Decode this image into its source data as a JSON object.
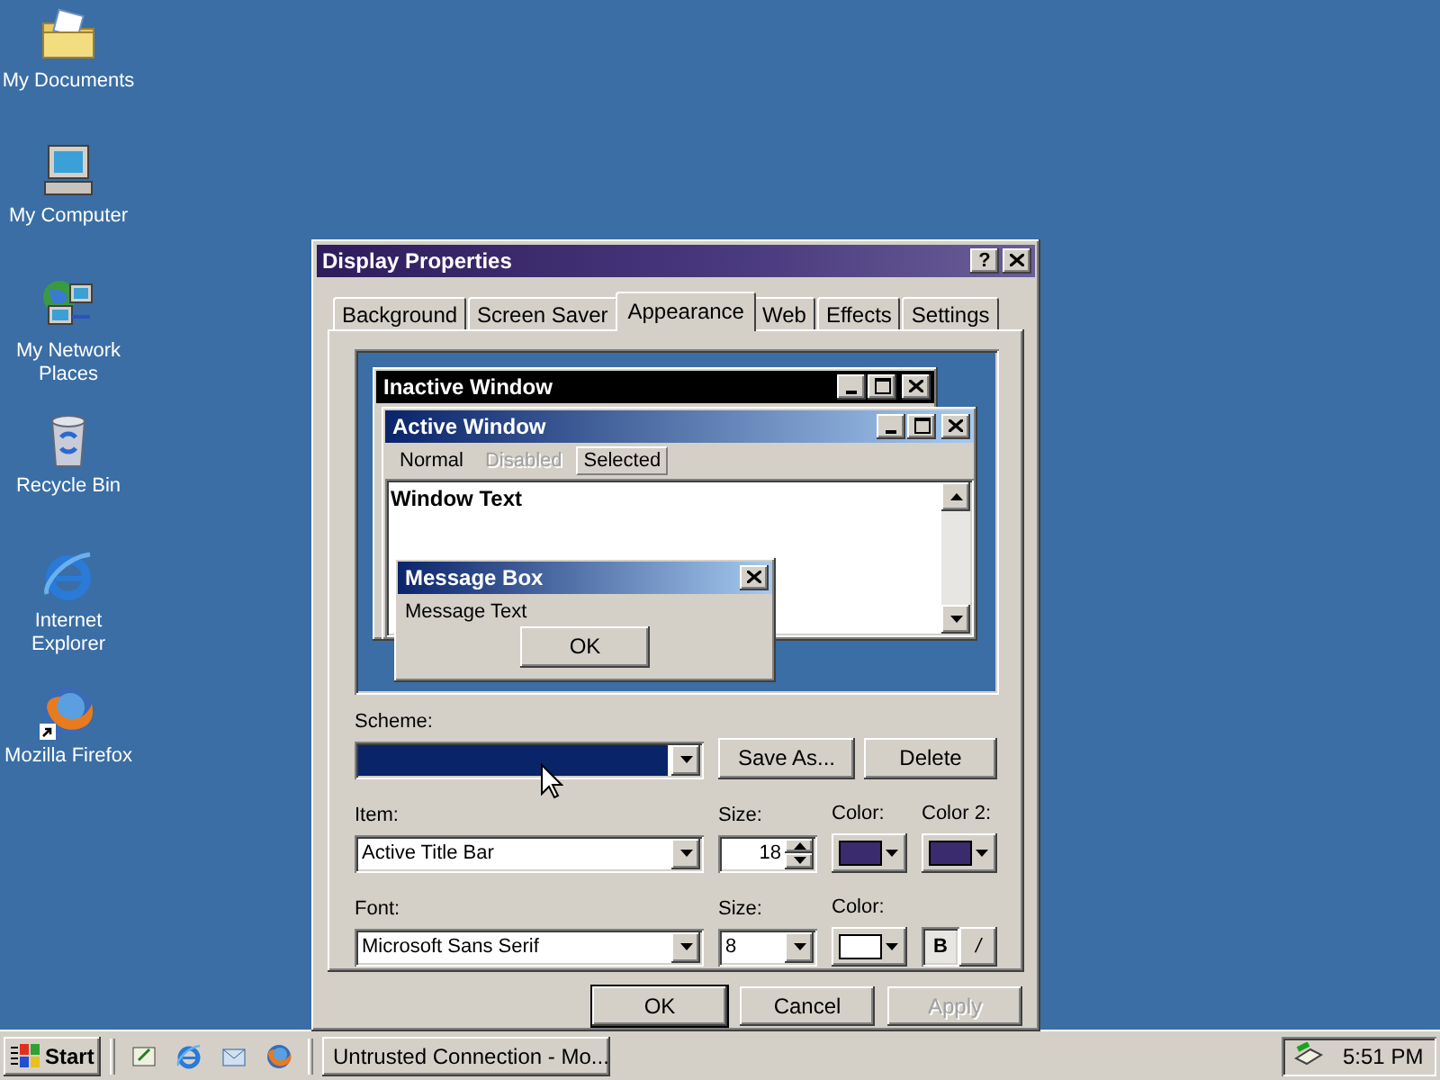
{
  "desktop_icons": [
    {
      "kind": "documents",
      "label": "My Documents"
    },
    {
      "kind": "computer",
      "label": "My Computer"
    },
    {
      "kind": "network",
      "label": "My Network Places"
    },
    {
      "kind": "recycle",
      "label": "Recycle Bin"
    },
    {
      "kind": "ie",
      "label": "Internet Explorer"
    },
    {
      "kind": "firefox",
      "label": "Mozilla Firefox"
    }
  ],
  "dialog": {
    "title": "Display Properties",
    "help": "?",
    "tabs": [
      {
        "label": "Background",
        "selected": false
      },
      {
        "label": "Screen Saver",
        "selected": false
      },
      {
        "label": "Appearance",
        "selected": true
      },
      {
        "label": "Web",
        "selected": false
      },
      {
        "label": "Effects",
        "selected": false
      },
      {
        "label": "Settings",
        "selected": false
      }
    ],
    "preview": {
      "inactive_title": "Inactive Window",
      "active_title": "Active Window",
      "menu": [
        {
          "label": "Normal",
          "disabled": false,
          "selected": false
        },
        {
          "label": "Disabled",
          "disabled": true,
          "selected": false
        },
        {
          "label": "Selected",
          "disabled": false,
          "selected": true
        }
      ],
      "window_text": "Window Text",
      "message_box": {
        "title": "Message Box",
        "text": "Message Text",
        "button": "OK"
      }
    },
    "scheme": {
      "label": "Scheme:",
      "selected": true
    },
    "scheme_buttons": [
      "Save As...",
      "Delete"
    ],
    "item": {
      "label": "Item:",
      "value": "Active Title Bar",
      "size_label": "Size:",
      "size": "18",
      "colors": [
        {
          "label": "Color:",
          "color": "#3a2a6e"
        },
        {
          "label": "Color 2:",
          "color": "#3a2a6e"
        }
      ]
    },
    "font": {
      "label": "Font:",
      "value": "Microsoft Sans Serif",
      "size_label": "Size:",
      "size": "8",
      "color_label": "Color:",
      "color": "#ffffff",
      "styles": [
        {
          "label": "B",
          "selected": true
        },
        {
          "label": "/",
          "selected": false
        }
      ]
    },
    "buttons": [
      {
        "label": "OK",
        "disabled": false
      },
      {
        "label": "Cancel",
        "disabled": false
      },
      {
        "label": "Apply",
        "disabled": true
      }
    ]
  },
  "taskbar": {
    "start": "Start",
    "quick_launch": [
      {
        "kind": "desktop"
      },
      {
        "kind": "ie"
      },
      {
        "kind": "outlook"
      },
      {
        "kind": "firefox"
      }
    ],
    "tasks": [
      {
        "label": "Untrusted Connection - Mo...",
        "selected": false
      }
    ],
    "clock": "5:51 PM"
  }
}
